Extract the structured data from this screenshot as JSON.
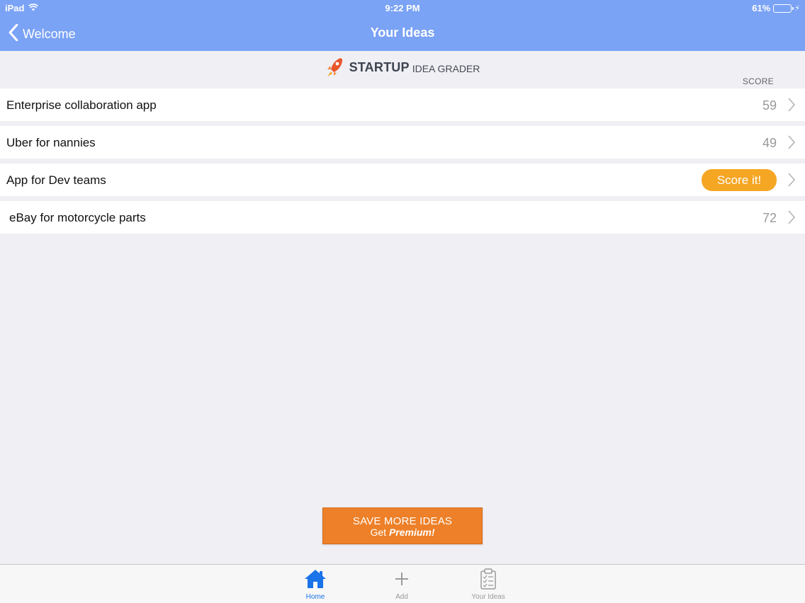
{
  "status": {
    "device": "iPad",
    "time": "9:22 PM",
    "battery": "61%",
    "battery_level": 0.61
  },
  "nav": {
    "back_label": "Welcome",
    "title": "Your Ideas"
  },
  "logo": {
    "strong": "STARTUP",
    "light": "IDEA GRADER"
  },
  "list": {
    "score_header": "SCORE",
    "items": [
      {
        "title": "Enterprise collaboration app",
        "score": "59"
      },
      {
        "title": "Uber for nannies",
        "score": "49"
      },
      {
        "title": "App for Dev teams",
        "action": "Score it!"
      },
      {
        "title": "eBay for motorcycle parts",
        "score": "72"
      }
    ]
  },
  "premium": {
    "line1": "SAVE MORE IDEAS",
    "line2_prefix": "Get ",
    "line2_bold": "Premium!"
  },
  "tabs": [
    {
      "label": "Home",
      "icon": "home-icon",
      "active": true
    },
    {
      "label": "Add",
      "icon": "plus-icon",
      "active": false
    },
    {
      "label": "Your Ideas",
      "icon": "clipboard-icon",
      "active": false
    }
  ],
  "colors": {
    "nav_bg": "#7aa2f5",
    "accent_orange": "#f5a623",
    "premium_orange": "#ed8028",
    "tab_active": "#1a73e8"
  }
}
